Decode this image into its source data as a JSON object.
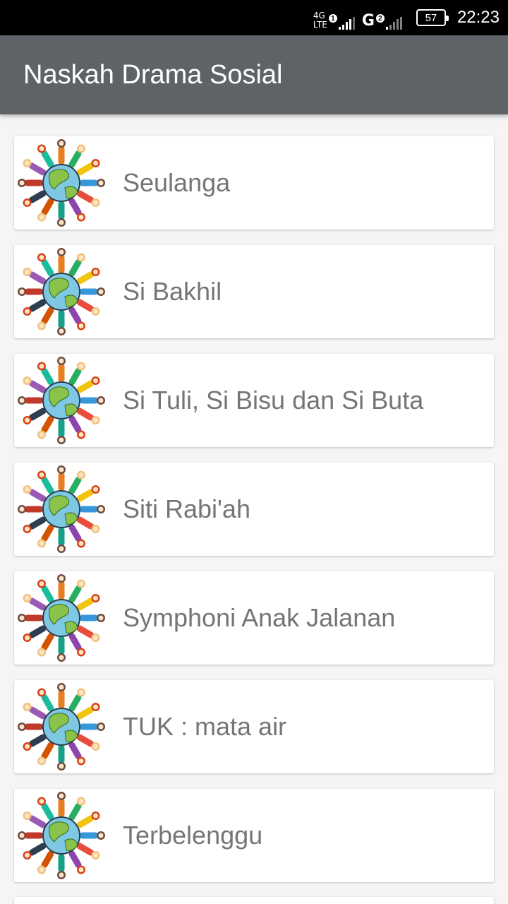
{
  "status_bar": {
    "network1_top": "4G",
    "network1_bottom": "LTE",
    "sim1": "1",
    "network2": "G",
    "sim2": "2",
    "battery": "57",
    "time": "22:23"
  },
  "app_bar": {
    "title": "Naskah Drama Sosial"
  },
  "items": [
    {
      "title": "Seulanga",
      "icon": "children-globe-icon"
    },
    {
      "title": "Si Bakhil",
      "icon": "children-globe-icon"
    },
    {
      "title": "Si Tuli, Si Bisu dan Si Buta",
      "icon": "children-globe-icon"
    },
    {
      "title": "Siti Rabi'ah",
      "icon": "children-globe-icon"
    },
    {
      "title": "Symphoni Anak Jalanan",
      "icon": "children-globe-icon"
    },
    {
      "title": "TUK : mata air",
      "icon": "children-globe-icon"
    },
    {
      "title": "Terbelenggu",
      "icon": "children-globe-icon"
    }
  ],
  "colors": {
    "app_bar": "#5f6368",
    "status_bar": "#000000",
    "background": "#f5f5f5",
    "item_text": "#757575"
  }
}
